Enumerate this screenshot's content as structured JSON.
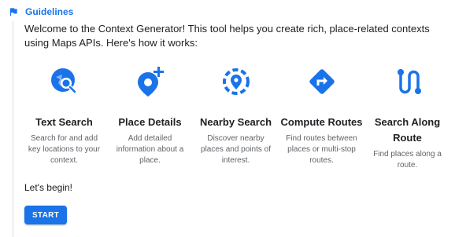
{
  "header": {
    "title": "Guidelines",
    "icon": "flag-icon"
  },
  "intro": "Welcome to the Context Generator! This tool helps you create rich, place-related contexts using Maps APIs. Here's how it works:",
  "features": [
    {
      "icon": "text-search-icon",
      "title": "Text Search",
      "description": "Search for and add key locations to your context."
    },
    {
      "icon": "place-details-icon",
      "title": "Place Details",
      "description": "Add detailed information about a place."
    },
    {
      "icon": "nearby-search-icon",
      "title": "Nearby Search",
      "description": "Discover nearby places and points of interest."
    },
    {
      "icon": "compute-routes-icon",
      "title": "Compute Routes",
      "description": "Find routes between places or multi-stop routes."
    },
    {
      "icon": "search-along-route-icon",
      "title": "Search Along Route",
      "description": "Find places along a route."
    }
  ],
  "begin_text": "Let's begin!",
  "start_label": "START",
  "colors": {
    "accent": "#1a73e8",
    "text": "#202124",
    "muted": "#5f6368"
  }
}
